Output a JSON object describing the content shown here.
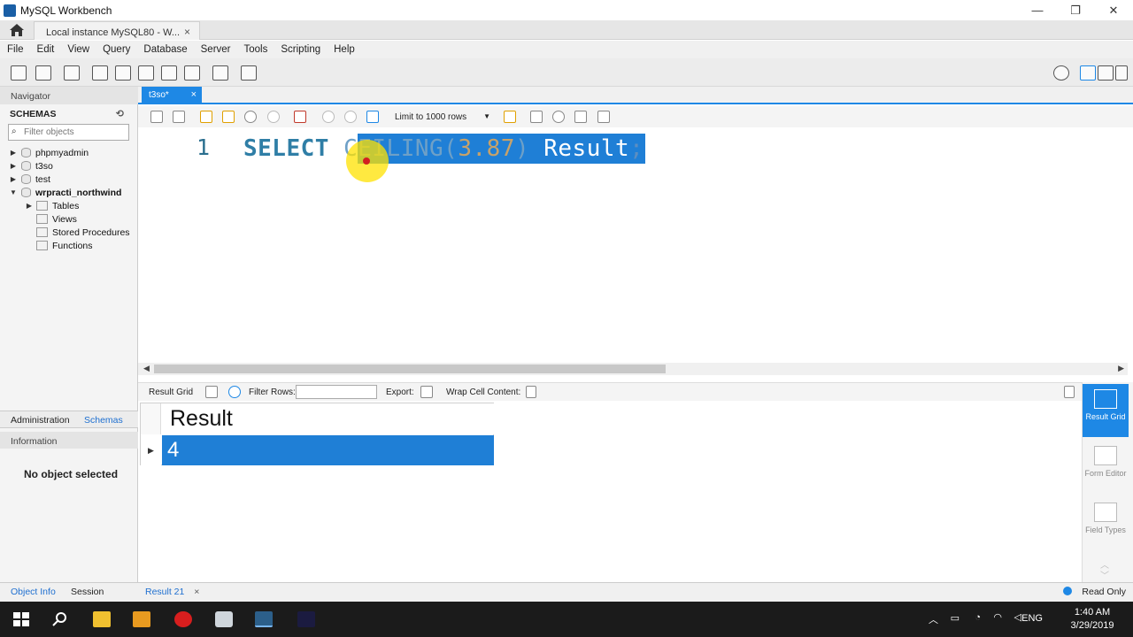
{
  "window": {
    "title": "MySQL Workbench",
    "connection_tab": "Local instance MySQL80 - W...",
    "controls": {
      "minimize": "—",
      "maximize": "❐",
      "close": "✕"
    }
  },
  "menu": [
    "File",
    "Edit",
    "View",
    "Query",
    "Database",
    "Server",
    "Tools",
    "Scripting",
    "Help"
  ],
  "navigator": {
    "title": "Navigator",
    "schemas_label": "SCHEMAS",
    "filter_placeholder": "Filter objects",
    "schemas": [
      {
        "name": "phpmyadmin",
        "expanded": false
      },
      {
        "name": "t3so",
        "expanded": false
      },
      {
        "name": "test",
        "expanded": false
      },
      {
        "name": "wrpracti_northwind",
        "expanded": true,
        "children": [
          "Tables",
          "Views",
          "Stored Procedures",
          "Functions"
        ]
      }
    ],
    "bottom_tabs": [
      "Administration",
      "Schemas"
    ],
    "information_title": "Information",
    "no_object": "No object selected",
    "footer_tabs": [
      "Object Info",
      "Session"
    ]
  },
  "editor": {
    "tab_label": "t3so*",
    "limit_label": "Limit to 1000 rows",
    "line_number": "1",
    "code": {
      "keyword": "SELECT",
      "pre_select": "C",
      "function_rest": "EILING",
      "open_paren": "(",
      "number": "3.87",
      "close_paren": ")",
      "alias": "Result",
      "semicolon": ";"
    }
  },
  "result_toolbar": {
    "result_grid": "Result Grid",
    "filter_rows": "Filter Rows:",
    "export": "Export:",
    "wrap": "Wrap Cell Content:"
  },
  "result_grid": {
    "columns": [
      "Result"
    ],
    "rows": [
      [
        "4"
      ]
    ]
  },
  "right_panel": [
    {
      "label": "Result Grid",
      "active": true
    },
    {
      "label": "Form Editor",
      "active": false
    },
    {
      "label": "Field Types",
      "active": false
    }
  ],
  "results_footer": {
    "tab": "Result 21",
    "status": "Read Only"
  },
  "taskbar": {
    "language": "ENG",
    "time": "1:40 AM",
    "date": "3/29/2019"
  },
  "colors": {
    "accent": "#1e88e5",
    "selection": "#1f7fd6",
    "keyword": "#2f7ea6",
    "number": "#c7a26a"
  }
}
